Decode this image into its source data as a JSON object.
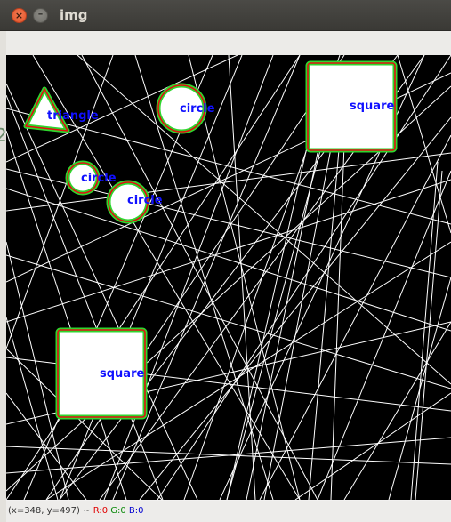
{
  "window": {
    "title": "img",
    "close_glyph": "×",
    "minimize_glyph": "–"
  },
  "canvas": {
    "background": "#000000",
    "line_color": "#ffffff",
    "outline_green": "#2ed62e",
    "outline_red": "#e01010",
    "label_color": "#1010ff",
    "shapes": [
      {
        "type": "triangle",
        "label": "triangle"
      },
      {
        "type": "circle",
        "label": "circle"
      },
      {
        "type": "square",
        "label": "square"
      },
      {
        "type": "circle",
        "label": "circle"
      },
      {
        "type": "circle",
        "label": "circle"
      },
      {
        "type": "square",
        "label": "square"
      }
    ]
  },
  "status": {
    "coords": "(x=348, y=497) ~",
    "r": "R:0",
    "g": "G:0",
    "b": "B:0"
  },
  "left_edge_glyph": "2"
}
